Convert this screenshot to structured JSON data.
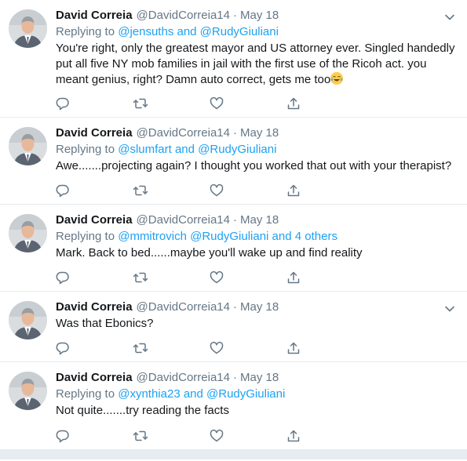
{
  "author": {
    "name": "David Correia",
    "handle": "@DavidCorreia14"
  },
  "icons": {
    "reply": "reply-icon",
    "retweet": "retweet-icon",
    "like": "heart-icon",
    "share": "share-icon",
    "more": "chevron-down-icon"
  },
  "colors": {
    "link": "#1da1f2",
    "secondary": "#657786",
    "text": "#14171a"
  },
  "tweets": [
    {
      "date": "May 18",
      "replying_prefix": "Replying to",
      "mentions": "@jensuths and @RudyGiuliani",
      "text": "You're right, only the greatest mayor and US attorney ever. Singled handedly put all five NY mob families in jail with the first use of the Ricoh act. you meant genius, right? Damn auto correct, gets me too",
      "emoji": "face-with-tears-of-joy"
    },
    {
      "date": "May 18",
      "replying_prefix": "Replying to",
      "mentions": "@slumfart and @RudyGiuliani",
      "text": "Awe.......projecting again? I thought you worked that out with your therapist?"
    },
    {
      "date": "May 18",
      "replying_prefix": "Replying to",
      "mentions": "@mmitrovich @RudyGiuliani and 4 others",
      "text": "Mark. Back to bed......maybe you'll wake up and find reality"
    },
    {
      "date": "May 18",
      "text": "Was that Ebonics?"
    },
    {
      "date": "May 18",
      "replying_prefix": "Replying to",
      "mentions": "@xynthia23 and @RudyGiuliani",
      "text": "Not quite.......try reading the facts"
    }
  ]
}
